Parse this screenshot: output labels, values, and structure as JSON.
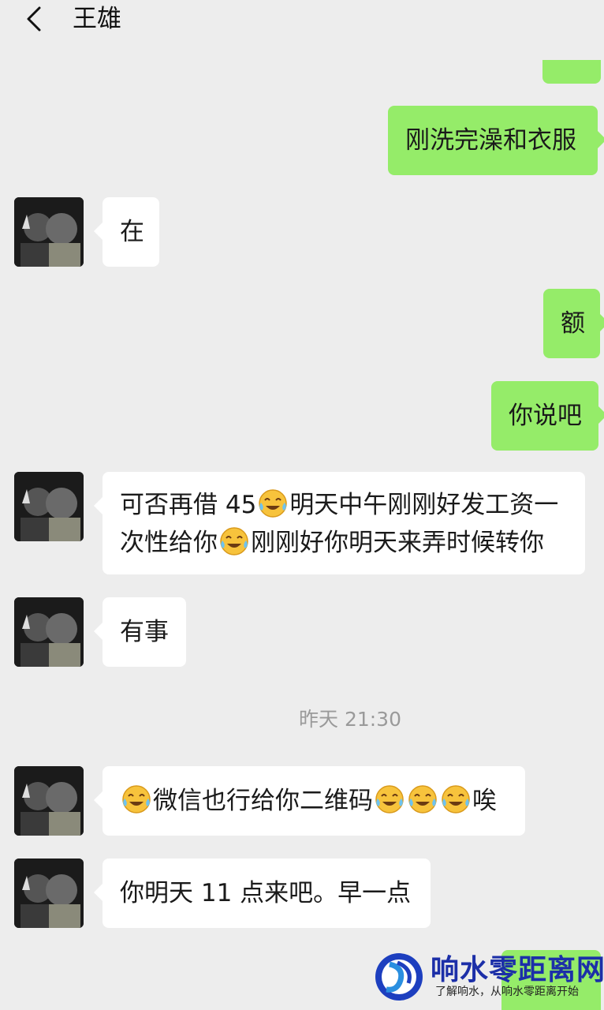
{
  "header": {
    "title": "王雄",
    "back_icon": "chevron-left-icon"
  },
  "colors": {
    "background": "#ededed",
    "sent_bubble": "#95ec69",
    "received_bubble": "#ffffff",
    "timestamp": "#9a9a9a"
  },
  "messages": [
    {
      "side": "right",
      "segments": [
        {
          "text": "刚洗完澡和衣服"
        }
      ]
    },
    {
      "side": "left",
      "segments": [
        {
          "text": "在"
        }
      ]
    },
    {
      "side": "right",
      "segments": [
        {
          "text": "额"
        }
      ]
    },
    {
      "side": "right",
      "segments": [
        {
          "text": "你说吧"
        }
      ]
    },
    {
      "side": "left",
      "segments": [
        {
          "text": "可否再借 45"
        },
        {
          "emoji": "crying-laughing-emoji"
        },
        {
          "text": "明天中午刚刚好发工资一"
        }
      ],
      "line2": [
        {
          "text": "次性给你"
        },
        {
          "emoji": "crying-laughing-emoji"
        },
        {
          "text": "刚刚好你明天来弄时候转你"
        }
      ]
    },
    {
      "side": "left",
      "segments": [
        {
          "text": "有事"
        }
      ]
    },
    {
      "side": "left",
      "segments": [
        {
          "emoji": "crying-laughing-emoji"
        },
        {
          "text": "微信也行给你二维码"
        },
        {
          "emoji": "crying-laughing-emoji"
        },
        {
          "emoji": "crying-laughing-emoji"
        },
        {
          "emoji": "crying-laughing-emoji"
        },
        {
          "text": "唉"
        }
      ]
    },
    {
      "side": "left",
      "segments": [
        {
          "text": "你明天 11 点来吧。早一点"
        }
      ]
    }
  ],
  "timestamp": "昨天 21:30",
  "watermark": {
    "brand": "响水零距离网",
    "slogan": "了解响水，从响水零距离开始"
  }
}
